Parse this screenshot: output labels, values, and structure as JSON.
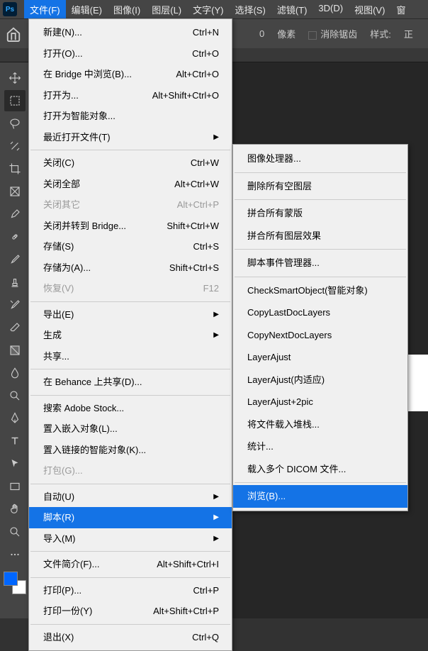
{
  "menubar": {
    "items": [
      "文件(F)",
      "编辑(E)",
      "图像(I)",
      "图层(L)",
      "文字(Y)",
      "选择(S)",
      "滤镜(T)",
      "3D(D)",
      "视图(V)",
      "窗"
    ]
  },
  "options_bar": {
    "pixels_label": "像素",
    "pixels_value": "0",
    "antialias_label": "消除锯齿",
    "style_label": "样式:",
    "style_value": "正"
  },
  "file_menu": {
    "items": [
      {
        "label": "新建(N)...",
        "shortcut": "Ctrl+N"
      },
      {
        "label": "打开(O)...",
        "shortcut": "Ctrl+O"
      },
      {
        "label": "在 Bridge 中浏览(B)...",
        "shortcut": "Alt+Ctrl+O"
      },
      {
        "label": "打开为...",
        "shortcut": "Alt+Shift+Ctrl+O"
      },
      {
        "label": "打开为智能对象..."
      },
      {
        "label": "最近打开文件(T)",
        "submenu": true
      },
      {
        "sep": true
      },
      {
        "label": "关闭(C)",
        "shortcut": "Ctrl+W"
      },
      {
        "label": "关闭全部",
        "shortcut": "Alt+Ctrl+W"
      },
      {
        "label": "关闭其它",
        "shortcut": "Alt+Ctrl+P",
        "disabled": true
      },
      {
        "label": "关闭并转到 Bridge...",
        "shortcut": "Shift+Ctrl+W"
      },
      {
        "label": "存储(S)",
        "shortcut": "Ctrl+S"
      },
      {
        "label": "存储为(A)...",
        "shortcut": "Shift+Ctrl+S"
      },
      {
        "label": "恢复(V)",
        "shortcut": "F12",
        "disabled": true
      },
      {
        "sep": true
      },
      {
        "label": "导出(E)",
        "submenu": true
      },
      {
        "label": "生成",
        "submenu": true
      },
      {
        "label": "共享..."
      },
      {
        "sep": true
      },
      {
        "label": "在 Behance 上共享(D)..."
      },
      {
        "sep": true
      },
      {
        "label": "搜索 Adobe Stock..."
      },
      {
        "label": "置入嵌入对象(L)..."
      },
      {
        "label": "置入链接的智能对象(K)..."
      },
      {
        "label": "打包(G)...",
        "disabled": true
      },
      {
        "sep": true
      },
      {
        "label": "自动(U)",
        "submenu": true
      },
      {
        "label": "脚本(R)",
        "submenu": true,
        "highlighted": true
      },
      {
        "label": "导入(M)",
        "submenu": true
      },
      {
        "sep": true
      },
      {
        "label": "文件简介(F)...",
        "shortcut": "Alt+Shift+Ctrl+I"
      },
      {
        "sep": true
      },
      {
        "label": "打印(P)...",
        "shortcut": "Ctrl+P"
      },
      {
        "label": "打印一份(Y)",
        "shortcut": "Alt+Shift+Ctrl+P"
      },
      {
        "sep": true
      },
      {
        "label": "退出(X)",
        "shortcut": "Ctrl+Q"
      }
    ]
  },
  "scripts_submenu": {
    "items": [
      {
        "label": "图像处理器..."
      },
      {
        "sep": true
      },
      {
        "label": "删除所有空图层"
      },
      {
        "sep": true
      },
      {
        "label": "拼合所有蒙版"
      },
      {
        "label": "拼合所有图层效果"
      },
      {
        "sep": true
      },
      {
        "label": "脚本事件管理器..."
      },
      {
        "sep": true
      },
      {
        "label": "CheckSmartObject(智能对象)"
      },
      {
        "label": "CopyLastDocLayers"
      },
      {
        "label": "CopyNextDocLayers"
      },
      {
        "label": "LayerAjust"
      },
      {
        "label": "LayerAjust(内适应)"
      },
      {
        "label": "LayerAjust+2pic"
      },
      {
        "label": "将文件载入堆栈..."
      },
      {
        "label": "统计..."
      },
      {
        "label": "载入多个 DICOM 文件..."
      },
      {
        "sep": true
      },
      {
        "label": "浏览(B)...",
        "highlighted": true
      }
    ]
  }
}
